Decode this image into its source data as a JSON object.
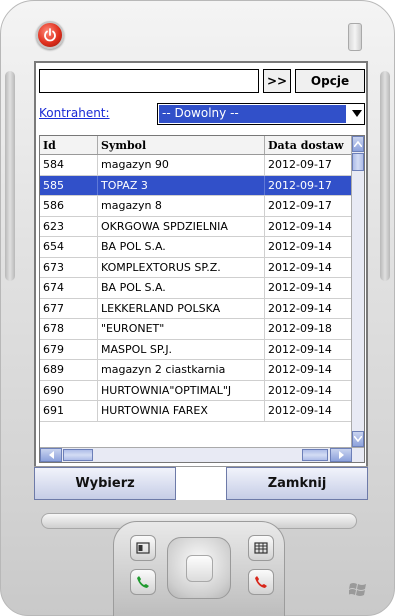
{
  "toolbar": {
    "search_value": "",
    "go_label": ">>",
    "options_label": "Opcje"
  },
  "filter": {
    "label": "Kontrahent:",
    "selected": "-- Dowolny --"
  },
  "grid": {
    "columns": [
      "Id",
      "Symbol",
      "Data dostaw"
    ],
    "rows": [
      {
        "id": "584",
        "symbol": "magazyn 90",
        "date": "2012-09-17"
      },
      {
        "id": "585",
        "symbol": "TOPAZ 3",
        "date": "2012-09-17"
      },
      {
        "id": "586",
        "symbol": "magazyn 8",
        "date": "2012-09-17"
      },
      {
        "id": "623",
        "symbol": "OKRGOWA SPDZIELNIA",
        "date": "2012-09-14"
      },
      {
        "id": "654",
        "symbol": "BA POL S.A.",
        "date": "2012-09-14"
      },
      {
        "id": "673",
        "symbol": "KOMPLEXTORUS SP.Z.",
        "date": "2012-09-14"
      },
      {
        "id": "674",
        "symbol": "BA POL S.A.",
        "date": "2012-09-14"
      },
      {
        "id": "677",
        "symbol": "LEKKERLAND POLSKA",
        "date": "2012-09-14"
      },
      {
        "id": "678",
        "symbol": "\"EURONET\"",
        "date": "2012-09-18"
      },
      {
        "id": "679",
        "symbol": "MASPOL SP.J.",
        "date": "2012-09-14"
      },
      {
        "id": "689",
        "symbol": "magazyn 2 ciastkarnia",
        "date": "2012-09-14"
      },
      {
        "id": "690",
        "symbol": "HURTOWNIA\"OPTIMAL\"J",
        "date": "2012-09-14"
      },
      {
        "id": "691",
        "symbol": "HURTOWNIA FAREX",
        "date": "2012-09-14"
      }
    ],
    "selected_row": 1
  },
  "softkeys": {
    "left": "Wybierz",
    "right": "Zamknij"
  },
  "colors": {
    "selection": "#3150c9",
    "link": "#1a2bd6",
    "power": "#e0301e"
  }
}
